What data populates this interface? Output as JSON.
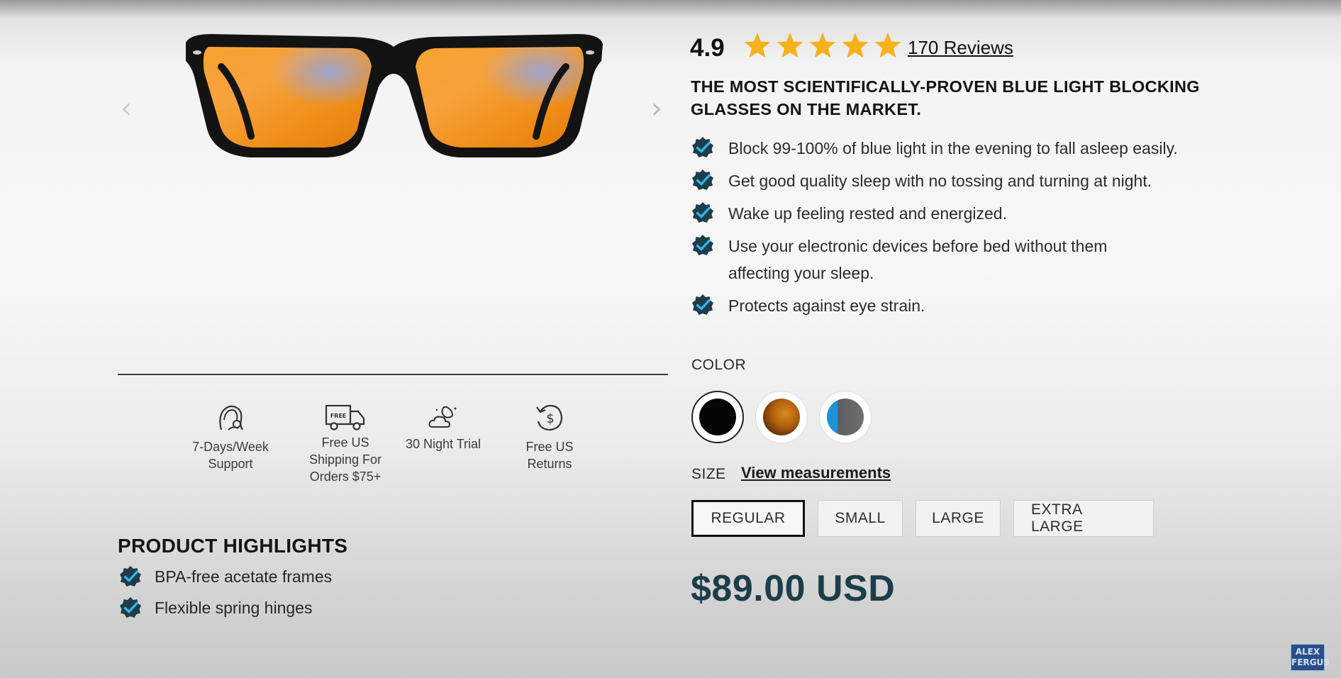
{
  "gallery": {
    "prev_glyph": "‹",
    "next_glyph": "›",
    "image_icon": "orange-lens-glasses"
  },
  "features": [
    {
      "icon": "support-headset-icon",
      "label_lines": [
        "7-Days/Week",
        "Support"
      ]
    },
    {
      "icon": "free-truck-icon",
      "truck_text": "FREE",
      "label_lines": [
        "Free US",
        "Shipping For",
        "Orders $75+"
      ]
    },
    {
      "icon": "night-moon-cloud-icon",
      "label_lines": [
        "30 Night Trial"
      ]
    },
    {
      "icon": "dollar-return-icon",
      "label_lines": [
        "Free US",
        "Returns"
      ]
    }
  ],
  "highlights": {
    "title": "PRODUCT HIGHLIGHTS",
    "items": [
      "BPA-free acetate frames",
      "Flexible spring hinges"
    ]
  },
  "rating": {
    "value": "4.9",
    "stars": 5,
    "reviews_label": "170 Reviews"
  },
  "headline_lines": [
    "THE MOST SCIENTIFICALLY-PROVEN BLUE LIGHT BLOCKING",
    "GLASSES ON THE MARKET."
  ],
  "bullets": [
    [
      "Block 99-100% of blue light in the evening to fall asleep easily."
    ],
    [
      "Get good quality sleep with no tossing and turning at night."
    ],
    [
      "Wake up feeling rested and energized."
    ],
    [
      "Use your electronic devices before bed without them",
      "affecting your sleep."
    ],
    [
      "Protects against eye strain."
    ]
  ],
  "color": {
    "label": "COLOR",
    "swatches": [
      {
        "name": "black",
        "selected": true
      },
      {
        "name": "tortoise",
        "selected": false
      },
      {
        "name": "blue-grey",
        "selected": false
      }
    ]
  },
  "size": {
    "label": "SIZE",
    "link": "View measurements",
    "options": [
      {
        "label": "REGULAR",
        "selected": true
      },
      {
        "label": "SMALL",
        "selected": false
      },
      {
        "label": "LARGE",
        "selected": false
      },
      {
        "label": "EXTRA LARGE",
        "selected": false
      }
    ]
  },
  "price": "$89.00 USD",
  "watermark_lines": [
    "ALEX",
    "FERGUS"
  ],
  "colors": {
    "star": "#f5b21b",
    "badge": "#1f3c4a",
    "badge_check": "#2fb6e6",
    "price": "#1c3d4a",
    "lens": "#f39a1e"
  }
}
